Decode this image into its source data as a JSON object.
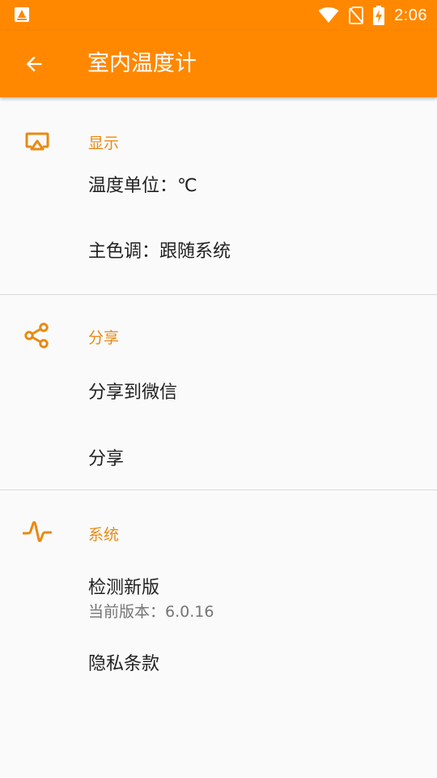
{
  "status_bar": {
    "time": "2:06",
    "icons": [
      "app-notification-icon",
      "wifi-icon",
      "no-sim-icon",
      "battery-charging-icon"
    ]
  },
  "app_bar": {
    "title": "室内温度计",
    "back_icon": "arrow-back-icon"
  },
  "sections": [
    {
      "title": "显示",
      "icon": "cast-display-icon",
      "items": [
        {
          "title": "温度单位：℃"
        },
        {
          "title": "主色调：跟随系统"
        }
      ]
    },
    {
      "title": "分享",
      "icon": "share-icon",
      "items": [
        {
          "title": "分享到微信"
        },
        {
          "title": "分享"
        }
      ]
    },
    {
      "title": "系统",
      "icon": "pulse-wave-icon",
      "items": [
        {
          "title": "检测新版",
          "summary": "当前版本：6.0.16"
        },
        {
          "title": "隐私条款"
        }
      ]
    }
  ],
  "colors": {
    "primary": "#ff8800",
    "accent": "#e98a12",
    "background": "#fafafa",
    "text_primary": "#212121",
    "text_secondary": "#757575",
    "divider": "#d9d9d9"
  }
}
